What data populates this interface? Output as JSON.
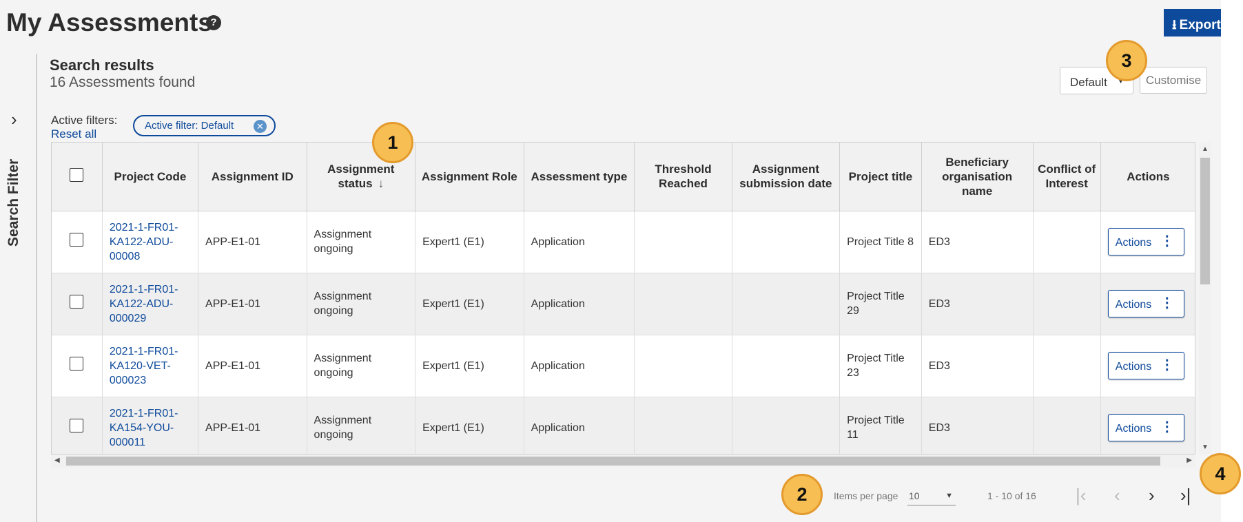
{
  "page": {
    "title": "My Assessments",
    "help_icon": "?",
    "export_label": "Export"
  },
  "filter_rail": {
    "label": "Search Filter",
    "toggle_icon": "›"
  },
  "results": {
    "title": "Search results",
    "count_text": "16 Assessments found"
  },
  "filters": {
    "active_label": "Active filters:",
    "reset_label": "Reset all",
    "chip_label": "Active filter: Default"
  },
  "view": {
    "selected": "Default",
    "customise_label": "Customise"
  },
  "table": {
    "headers": {
      "project_code": "Project Code",
      "assignment_id": "Assignment ID",
      "assignment_status": "Assignment status",
      "assignment_role": "Assignment Role",
      "assessment_type": "Assessment type",
      "threshold_reached": "Threshold Reached",
      "submission_date": "Assignment submission date",
      "project_title": "Project title",
      "beneficiary": "Beneficiary organisation name",
      "conflict": "Conflict of Interest",
      "actions": "Actions"
    },
    "rows": [
      {
        "project_code": "2021-1-FR01-KA122-ADU-00008",
        "assignment_id": "APP-E1-01",
        "status": "Assignment ongoing",
        "role": "Expert1 (E1)",
        "type": "Application",
        "threshold": "",
        "submission_date": "",
        "project_title": "Project Title 8",
        "beneficiary": "ED3",
        "conflict": "",
        "action_label": "Actions"
      },
      {
        "project_code": "2021-1-FR01-KA122-ADU-000029",
        "assignment_id": "APP-E1-01",
        "status": "Assignment ongoing",
        "role": "Expert1 (E1)",
        "type": "Application",
        "threshold": "",
        "submission_date": "",
        "project_title": "Project Title 29",
        "beneficiary": "ED3",
        "conflict": "",
        "action_label": "Actions"
      },
      {
        "project_code": "2021-1-FR01-KA120-VET-000023",
        "assignment_id": "APP-E1-01",
        "status": "Assignment ongoing",
        "role": "Expert1 (E1)",
        "type": "Application",
        "threshold": "",
        "submission_date": "",
        "project_title": "Project Title 23",
        "beneficiary": "ED3",
        "conflict": "",
        "action_label": "Actions"
      },
      {
        "project_code": "2021-1-FR01-KA154-YOU-000011",
        "assignment_id": "APP-E1-01",
        "status": "Assignment ongoing",
        "role": "Expert1 (E1)",
        "type": "Application",
        "threshold": "",
        "submission_date": "",
        "project_title": "Project Title 11",
        "beneficiary": "ED3",
        "conflict": "",
        "action_label": "Actions"
      }
    ]
  },
  "pagination": {
    "items_per_page_label": "Items per page",
    "items_per_page_value": "10",
    "range_text": "1 - 10 of 16",
    "first_icon": "|‹",
    "prev_icon": "‹",
    "next_icon": "›",
    "last_icon": "›|"
  },
  "callouts": [
    "1",
    "2",
    "3",
    "4"
  ],
  "colors": {
    "brand_blue": "#0e4a9b",
    "callout_fill": "#f7bf53",
    "callout_border": "#e49a2c"
  }
}
